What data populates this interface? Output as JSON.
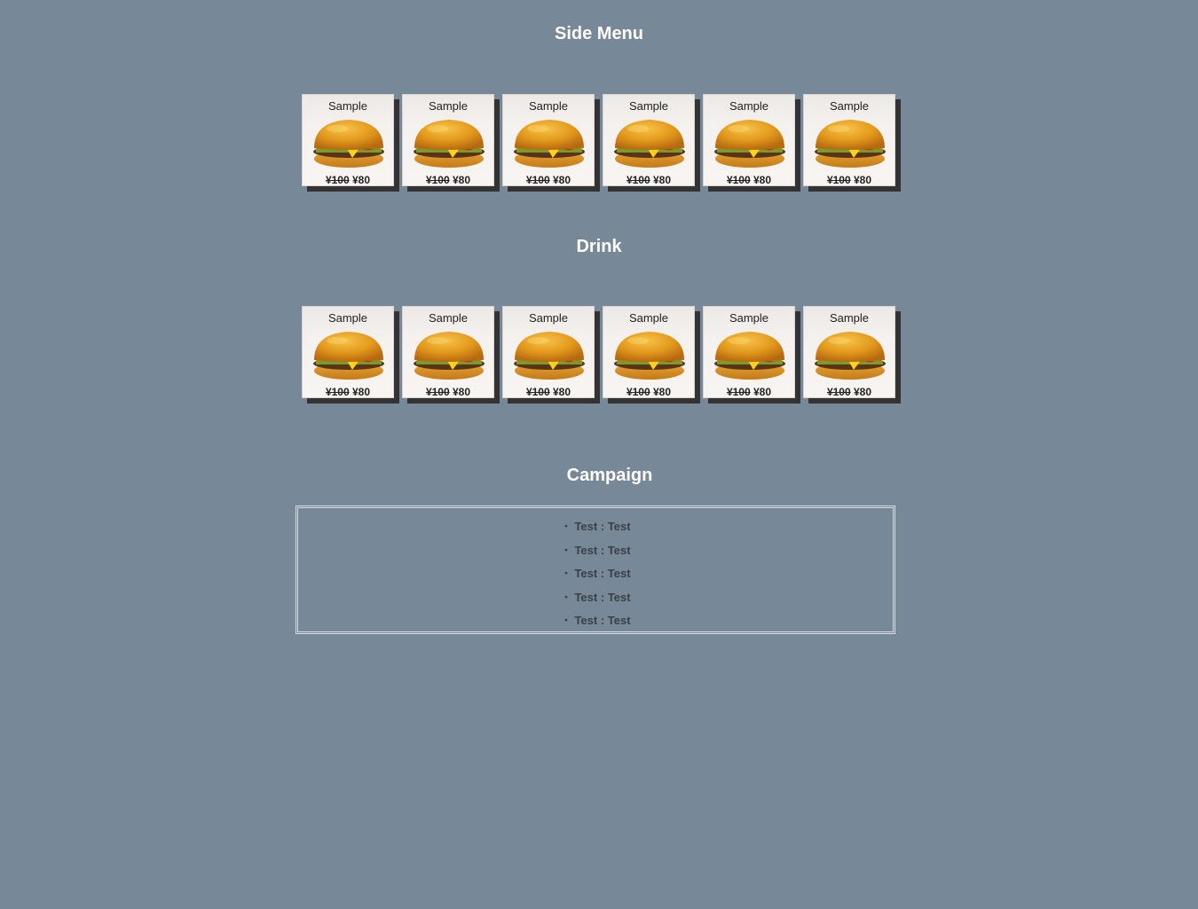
{
  "sections": {
    "side_menu_title": "Side Menu",
    "drink_title": "Drink",
    "campaign_title": "Campaign"
  },
  "side_menu": [
    {
      "name": "Sample",
      "old_price": "¥100",
      "price": "¥80",
      "image_icon": "cheeseburger-image"
    },
    {
      "name": "Sample",
      "old_price": "¥100",
      "price": "¥80",
      "image_icon": "cheeseburger-image"
    },
    {
      "name": "Sample",
      "old_price": "¥100",
      "price": "¥80",
      "image_icon": "cheeseburger-image"
    },
    {
      "name": "Sample",
      "old_price": "¥100",
      "price": "¥80",
      "image_icon": "cheeseburger-image"
    },
    {
      "name": "Sample",
      "old_price": "¥100",
      "price": "¥80",
      "image_icon": "cheeseburger-image"
    },
    {
      "name": "Sample",
      "old_price": "¥100",
      "price": "¥80",
      "image_icon": "cheeseburger-image"
    }
  ],
  "drink": [
    {
      "name": "Sample",
      "old_price": "¥100",
      "price": "¥80",
      "image_icon": "cheeseburger-image"
    },
    {
      "name": "Sample",
      "old_price": "¥100",
      "price": "¥80",
      "image_icon": "cheeseburger-image"
    },
    {
      "name": "Sample",
      "old_price": "¥100",
      "price": "¥80",
      "image_icon": "cheeseburger-image"
    },
    {
      "name": "Sample",
      "old_price": "¥100",
      "price": "¥80",
      "image_icon": "cheeseburger-image"
    },
    {
      "name": "Sample",
      "old_price": "¥100",
      "price": "¥80",
      "image_icon": "cheeseburger-image"
    },
    {
      "name": "Sample",
      "old_price": "¥100",
      "price": "¥80",
      "image_icon": "cheeseburger-image"
    }
  ],
  "campaign": [
    {
      "bullet": "・",
      "text": "Test : Test"
    },
    {
      "bullet": "・",
      "text": "Test : Test"
    },
    {
      "bullet": "・",
      "text": "Test : Test"
    },
    {
      "bullet": "・",
      "text": "Test : Test"
    },
    {
      "bullet": "・",
      "text": "Test : Test"
    }
  ],
  "colors": {
    "background": "#778899",
    "title": "#ffffff",
    "card_shadow": "#333333",
    "campaign_text": "#3b3f44"
  }
}
